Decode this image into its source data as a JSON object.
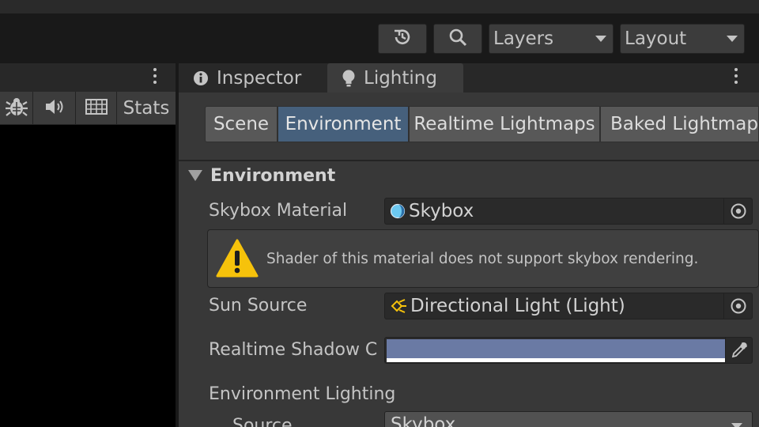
{
  "toolbar": {
    "history_icon": "history-icon",
    "search_icon": "search-icon",
    "layers_label": "Layers",
    "layout_label": "Layout"
  },
  "game_view": {
    "stats_label": "Stats",
    "icons": [
      "bug-icon",
      "speaker-icon",
      "grid-icon"
    ]
  },
  "inspector_window": {
    "tabs": [
      {
        "label": "Inspector",
        "icon": "info-icon",
        "active": false
      },
      {
        "label": "Lighting",
        "icon": "lightbulb-icon",
        "active": true
      }
    ],
    "lighting_tabs": [
      {
        "label": "Scene",
        "active": false
      },
      {
        "label": "Environment",
        "active": true
      },
      {
        "label": "Realtime Lightmaps",
        "active": false
      },
      {
        "label": "Baked Lightmaps",
        "active": false
      }
    ],
    "section_title": "Environment",
    "skybox_material": {
      "label": "Skybox Material",
      "value": "Skybox"
    },
    "warning": {
      "message": "Shader of this material does not support skybox rendering."
    },
    "sun_source": {
      "label": "Sun Source",
      "value": "Directional Light (Light)"
    },
    "shadow_color": {
      "label": "Realtime Shadow C",
      "color": "#6a7aa4"
    },
    "environment_lighting": {
      "label": "Environment Lighting"
    },
    "source": {
      "label": "Source",
      "value": "Skybox"
    }
  },
  "colors": {
    "accent_selected": "#46607c",
    "warning_yellow": "#f6c20b",
    "skybox_icon": "#6cc8f0"
  }
}
